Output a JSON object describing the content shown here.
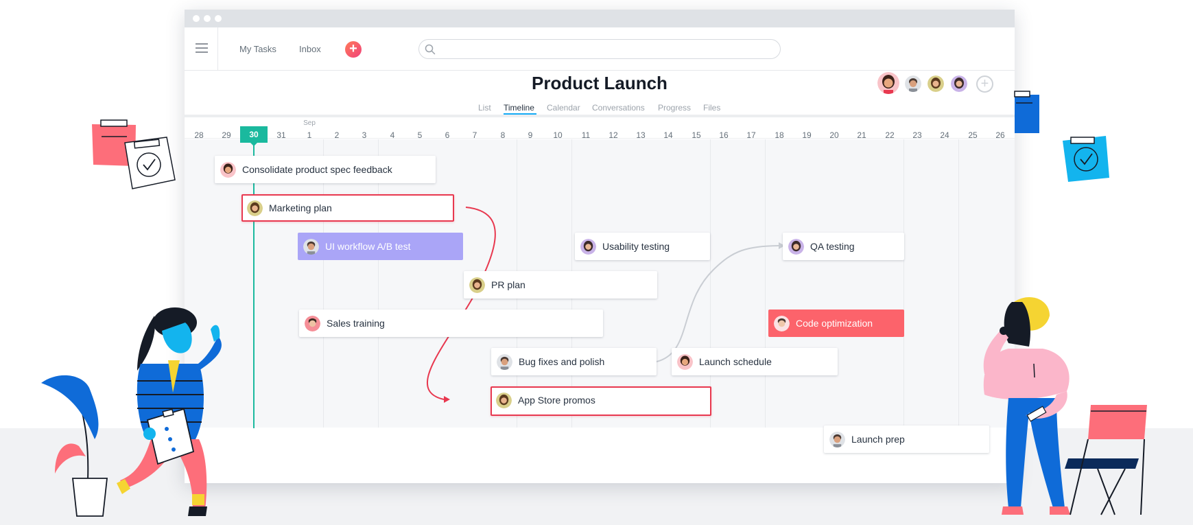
{
  "nav": {
    "my_tasks": "My Tasks",
    "inbox": "Inbox",
    "add": "+"
  },
  "search": {
    "placeholder": ""
  },
  "project": {
    "title": "Product Launch"
  },
  "tabs": [
    {
      "label": "List",
      "active": false
    },
    {
      "label": "Timeline",
      "active": true
    },
    {
      "label": "Calendar",
      "active": false
    },
    {
      "label": "Conversations",
      "active": false
    },
    {
      "label": "Progress",
      "active": false
    },
    {
      "label": "Files",
      "active": false
    }
  ],
  "timeline": {
    "month_label": "Sep",
    "today": "30",
    "days": [
      "28",
      "29",
      "30",
      "31",
      "1",
      "2",
      "3",
      "4",
      "5",
      "6",
      "7",
      "8",
      "9",
      "10",
      "11",
      "12",
      "13",
      "14",
      "15",
      "16",
      "17",
      "18",
      "19",
      "20",
      "21",
      "22",
      "23",
      "24",
      "25",
      "26"
    ]
  },
  "tasks": [
    {
      "name": "Consolidate product spec feedback",
      "style": "normal",
      "avatar": "avatar-woman-pink"
    },
    {
      "name": "Marketing plan",
      "style": "highlight-red",
      "avatar": "avatar-woman-olive"
    },
    {
      "name": "UI workflow A/B test",
      "style": "purple",
      "avatar": "avatar-man-grey"
    },
    {
      "name": "Usability testing",
      "style": "normal",
      "avatar": "avatar-woman-purple"
    },
    {
      "name": "QA testing",
      "style": "normal",
      "avatar": "avatar-woman-purple"
    },
    {
      "name": "PR plan",
      "style": "normal",
      "avatar": "avatar-woman-olive"
    },
    {
      "name": "Sales training",
      "style": "normal",
      "avatar": "avatar-man-pink"
    },
    {
      "name": "Code optimization",
      "style": "coral",
      "avatar": "avatar-man-light"
    },
    {
      "name": "Bug fixes and polish",
      "style": "normal",
      "avatar": "avatar-man-grey"
    },
    {
      "name": "Launch schedule",
      "style": "normal",
      "avatar": "avatar-woman-pink"
    },
    {
      "name": "App Store promos",
      "style": "highlight-red",
      "avatar": "avatar-woman-olive"
    },
    {
      "name": "Launch prep",
      "style": "normal",
      "avatar": "avatar-man-grey"
    }
  ],
  "colors": {
    "today": "#1ab99e",
    "red_border": "#e8384f",
    "purple_task": "#aaa5f7",
    "coral_task": "#fc636b",
    "tab_active_underline": "#14aaf5",
    "dependency_red": "#e8384f",
    "dependency_grey": "#c9cdd3"
  }
}
